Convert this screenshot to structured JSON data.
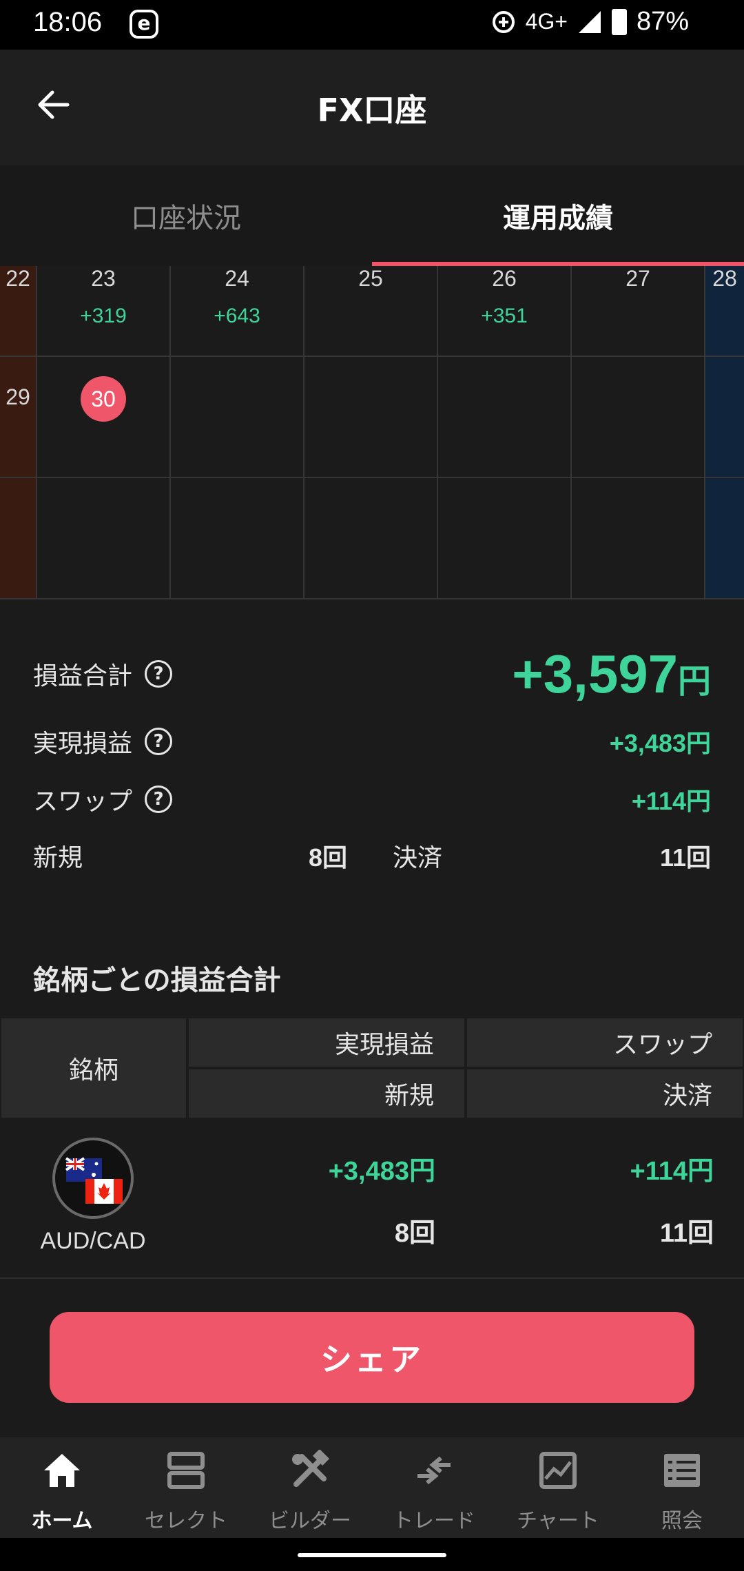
{
  "status_bar": {
    "time": "18:06",
    "e_badge": "e",
    "network": "4G+",
    "battery": "87%"
  },
  "header": {
    "title": "FX口座"
  },
  "tabs": [
    {
      "label": "口座状況",
      "active": false
    },
    {
      "label": "運用成績",
      "active": true
    }
  ],
  "calendar": {
    "week1": {
      "sun": "22",
      "days": [
        "23",
        "24",
        "25",
        "26",
        "27"
      ],
      "pnl": [
        "+319",
        "+643",
        "",
        "+351",
        ""
      ],
      "sat": "28"
    },
    "week2": {
      "sun": "29",
      "today": "30"
    }
  },
  "summary": {
    "total_label": "損益合計",
    "total_value": "+3,597",
    "total_unit": "円",
    "realized_label": "実現損益",
    "realized_value": "+3,483円",
    "swap_label": "スワップ",
    "swap_value": "+114円",
    "new_label": "新規",
    "new_count": "8回",
    "settle_label": "決済",
    "settle_count": "11回"
  },
  "by_symbol": {
    "title": "銘柄ごとの損益合計",
    "headers": {
      "symbol": "銘柄",
      "realized": "実現損益",
      "swap": "スワップ",
      "new": "新規",
      "settle": "決済"
    },
    "rows": [
      {
        "pair": "AUD/CAD",
        "realized": "+3,483円",
        "swap": "+114円",
        "new": "8回",
        "settle": "11回"
      }
    ]
  },
  "share": {
    "label": "シェア"
  },
  "bottom_nav": [
    {
      "label": "ホーム",
      "icon": "home-icon",
      "active": true
    },
    {
      "label": "セレクト",
      "icon": "select-icon",
      "active": false
    },
    {
      "label": "ビルダー",
      "icon": "builder-icon",
      "active": false
    },
    {
      "label": "トレード",
      "icon": "trade-icon",
      "active": false
    },
    {
      "label": "チャート",
      "icon": "chart-icon",
      "active": false
    },
    {
      "label": "照会",
      "icon": "list-icon",
      "active": false
    }
  ],
  "colors": {
    "accent": "#f0566a",
    "profit": "#3fd59a",
    "sunday": "#3a1b12",
    "saturday": "#10253c"
  }
}
